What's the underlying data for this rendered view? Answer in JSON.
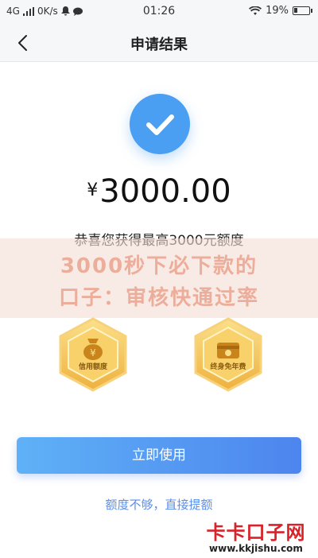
{
  "status_bar": {
    "network": "4G",
    "speed": "0K/s",
    "time": "01:26",
    "battery": "19%"
  },
  "nav": {
    "title": "申请结果"
  },
  "result": {
    "currency_symbol": "¥",
    "amount": "3000.00",
    "message": "恭喜您获得最高3000元额度"
  },
  "watermark": {
    "line1": "3000秒下必下款的",
    "line2": "口子：审核快通过率"
  },
  "badges": [
    {
      "label": "信用额度",
      "icon": "money-bag-icon"
    },
    {
      "label": "终身免年费",
      "icon": "card-icon"
    }
  ],
  "actions": {
    "primary_label": "立即使用",
    "link_label": "额度不够，直接提额"
  },
  "site_logo": {
    "title": "卡卡口子网",
    "url": "www.kkjishu.com"
  },
  "colors": {
    "accent": "#4a9ff2",
    "button_start": "#5fb1f7",
    "button_end": "#4d85ee",
    "link": "#5a8fe8",
    "badge_gold": "#f3c458",
    "logo_red": "#d8232a"
  }
}
